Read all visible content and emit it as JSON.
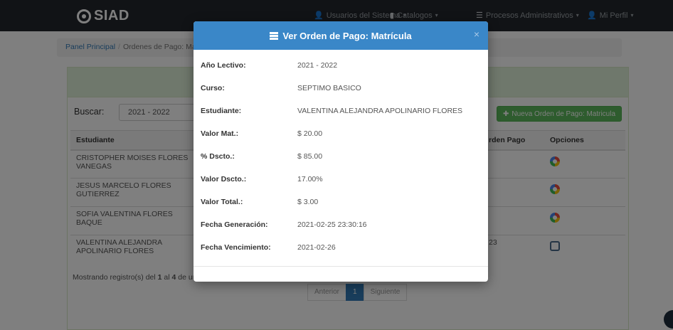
{
  "navbar": {
    "brand": "SIAD",
    "menu": [
      {
        "label": "Usuarios del Sistema",
        "icon": "users-icon"
      },
      {
        "label": "Catalogos",
        "icon": "book-icon"
      },
      {
        "label": "Procesos Administrativos",
        "icon": "list-icon"
      },
      {
        "label": "Mi Perfil",
        "icon": "user-icon"
      }
    ]
  },
  "breadcrumb": {
    "home": "Panel Principal",
    "current": "Ordenes de Pago: Ma"
  },
  "search": {
    "label": "Buscar:",
    "value": "2021 - 2022"
  },
  "new_button": "Nueva Orden de Pago: Matricula",
  "table": {
    "headers": {
      "student": "Estudiante",
      "order": "rden Pago",
      "options": "Opciones"
    },
    "rows": [
      {
        "student": "CRISTOPHER MOISES FLORES VANEGAS",
        "order": "",
        "option_icon": "color-wheel-icon"
      },
      {
        "student": "JESUS MARCELO FLORES GUTIERREZ",
        "order": "",
        "option_icon": "color-wheel-icon"
      },
      {
        "student": "SOFIA VALENTINA FLORES BAQUE",
        "order": "",
        "option_icon": "color-wheel-icon"
      },
      {
        "student": "VALENTINA ALEJANDRA APOLINARIO FLORES",
        "order": "23",
        "option_icon": "document-icon"
      }
    ]
  },
  "info": {
    "prefix": "Mostrando registro(s) del ",
    "from": "1",
    "mid": " al ",
    "to": "4",
    "suffix": " de un t"
  },
  "pagination": {
    "prev": "Anterior",
    "page": "1",
    "next": "Siguiente"
  },
  "modal": {
    "title": "Ver Orden de Pago: Matrícula",
    "close": "×",
    "fields": [
      {
        "label": "Año Lectivo:",
        "value": "2021 - 2022"
      },
      {
        "label": "Curso:",
        "value": "SEPTIMO BASICO"
      },
      {
        "label": "Estudiante:",
        "value": "VALENTINA ALEJANDRA APOLINARIO FLORES"
      },
      {
        "label": "Valor Mat.:",
        "value": "$ 20.00"
      },
      {
        "label": "% Dscto.:",
        "value": "$ 85.00"
      },
      {
        "label": "Valor Dscto.:",
        "value": "17.00%"
      },
      {
        "label": "Valor Total.:",
        "value": "$ 3.00"
      },
      {
        "label": "Fecha Generación:",
        "value": "2021-02-25 23:30:16"
      },
      {
        "label": "Fecha Vencimiento:",
        "value": "2021-02-26"
      }
    ]
  },
  "colors": {
    "navbar": "#23272c",
    "modal_header": "#3a87c8",
    "success": "#5cb85c",
    "panel_heading": "#dff0d8"
  }
}
